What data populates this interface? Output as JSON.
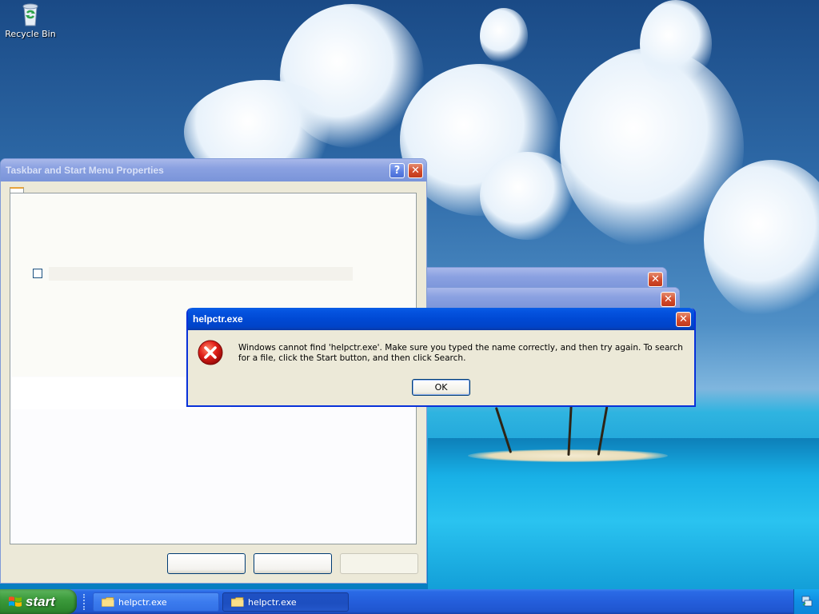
{
  "desktop": {
    "icons": [
      {
        "label": "Recycle Bin",
        "icon": "recycle-bin-icon"
      }
    ]
  },
  "taskbar_properties_window": {
    "title": "Taskbar and Start Menu Properties",
    "help_glyph": "?",
    "close_glyph": "✕"
  },
  "background_windows": [
    {
      "close_glyph": "✕"
    },
    {
      "close_glyph": "✕"
    }
  ],
  "error_dialog": {
    "title": "helpctr.exe",
    "message": "Windows cannot find 'helpctr.exe'. Make sure you typed the name correctly, and then try again. To search for a file, click the Start button, and then click Search.",
    "ok_label": "OK",
    "close_glyph": "✕",
    "icon": "error-icon"
  },
  "taskbar": {
    "start_label": "start",
    "tasks": [
      {
        "label": "helpctr.exe",
        "icon": "folder-icon",
        "state": "normal"
      },
      {
        "label": "helpctr.exe",
        "icon": "folder-icon",
        "state": "pressed"
      }
    ],
    "tray_icon": "network-icon"
  },
  "colors": {
    "titlebar_active": "#0054e3",
    "titlebar_inactive": "#7a94d9",
    "window_face": "#ece9d8",
    "start_green": "#3c9b3c",
    "taskbar_blue": "#245edb"
  }
}
